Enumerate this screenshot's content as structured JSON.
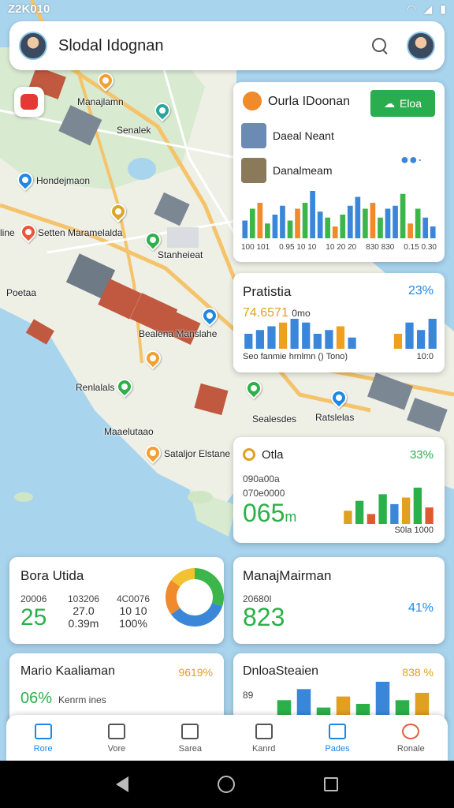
{
  "status_bar": {
    "time": "Z2K010",
    "icons": [
      "wifi-icon",
      "signal-icon",
      "battery-icon"
    ]
  },
  "search": {
    "title": "Slodal Idognan"
  },
  "map_labels": [
    {
      "text": "Manajlamn"
    },
    {
      "text": "Senalek"
    },
    {
      "text": "Hondejmaon"
    },
    {
      "text": "Setten Maramelalda"
    },
    {
      "text": "Stanheieat"
    },
    {
      "text": "Bealena Manslahe"
    },
    {
      "text": "Poetaa"
    },
    {
      "text": "Renlalals"
    },
    {
      "text": "Sealesdes"
    },
    {
      "text": "Ratslelas"
    },
    {
      "text": "Maaelutaao"
    },
    {
      "text": "Sataljor Elstane"
    },
    {
      "text": "line"
    }
  ],
  "card_top": {
    "title": "Ourla IDoonan",
    "button": "Eloa",
    "users": [
      "Daeal Neant",
      "Danalmeam"
    ],
    "tick_labels": [
      "100 101",
      "0.95 10 10",
      "10 20 20",
      "830 830",
      "0.15 0.30"
    ],
    "colors": {
      "green": "#3cb64a",
      "blue": "#3a86d8",
      "orange": "#f08a2a"
    }
  },
  "card_stats": {
    "title": "Pratistia",
    "percent": "23%",
    "value": "74.6571",
    "value_unit": "0mo",
    "footer_left": "Seo fanmie hrnlmn () Tono)",
    "footer_right": "10:0"
  },
  "card_otla": {
    "title": "Otla",
    "percent": "33%",
    "line1": "090a00a",
    "line2": "070e0000",
    "value": "065",
    "unit": "m",
    "footer": "S0la 1000"
  },
  "card_bora": {
    "title": "Bora Utida",
    "stats": [
      {
        "label": "20006",
        "value": "25"
      },
      {
        "label": "103206",
        "value": "27.0",
        "sub": "0.39m"
      },
      {
        "label": "4C0076",
        "value": "10 10",
        "sub": "100%"
      }
    ],
    "donut": [
      {
        "label": "green",
        "value": 30
      },
      {
        "label": "blue",
        "value": 35
      },
      {
        "label": "orange",
        "value": 20
      },
      {
        "label": "yellow",
        "value": 15
      }
    ]
  },
  "card_manaj": {
    "title": "ManajMairman",
    "label": "20680I",
    "value": "823",
    "percent": "41%"
  },
  "card_mario": {
    "title": "Mario Kaaliaman",
    "percent": "9619%",
    "value": "06%",
    "sub": "Kenrm ines"
  },
  "card_dnloa": {
    "title": "DnloaSteaien",
    "percent": "838 %",
    "axis": "89"
  },
  "bottom_nav": [
    {
      "label": "Rore",
      "icon": "home-icon"
    },
    {
      "label": "Vore",
      "icon": "map-icon"
    },
    {
      "label": "Sarea",
      "icon": "bag-icon"
    },
    {
      "label": "Kanrd",
      "icon": "inbox-icon"
    },
    {
      "label": "Pades",
      "icon": "pages-icon"
    },
    {
      "label": "Ronale",
      "icon": "profile-icon"
    }
  ],
  "chart_data": [
    {
      "type": "bar",
      "series": [
        {
          "values": [
            30,
            50,
            60,
            25,
            40,
            55,
            30,
            50,
            60,
            80,
            45,
            35,
            20,
            40,
            55,
            70,
            50,
            60,
            35,
            50,
            55,
            75,
            25,
            50,
            35,
            20
          ]
        }
      ]
    },
    {
      "type": "bar",
      "series": [
        {
          "values": [
            20,
            25,
            30,
            35,
            40,
            35,
            20,
            25,
            30,
            15
          ]
        },
        {
          "values": [
            20,
            35,
            25,
            40,
            30,
            45,
            35,
            30
          ]
        }
      ]
    },
    {
      "type": "bar",
      "series": [
        {
          "values": [
            20,
            35,
            15,
            45,
            30,
            40,
            55,
            25
          ]
        }
      ]
    },
    {
      "type": "bar",
      "series": [
        {
          "values": [
            20,
            35,
            10,
            25,
            15,
            45,
            20,
            30
          ]
        }
      ]
    }
  ]
}
